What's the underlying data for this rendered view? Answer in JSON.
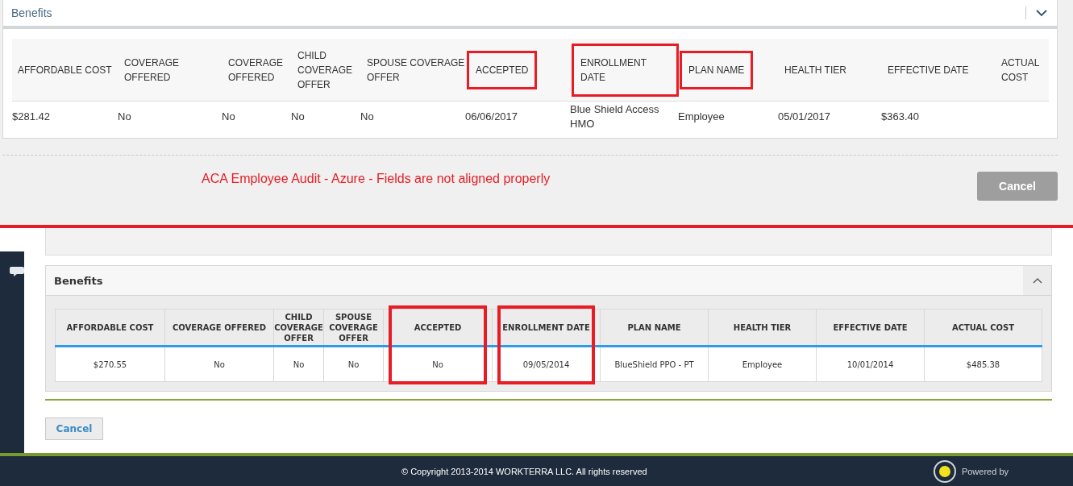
{
  "top": {
    "panel_title": "Benefits",
    "columns": [
      {
        "label": "AFFORDABLE COST",
        "highlighted": false
      },
      {
        "label": "COVERAGE OFFERED",
        "highlighted": false
      },
      {
        "label": "COVERAGE OFFERED",
        "highlighted": false
      },
      {
        "label": "CHILD COVERAGE OFFER",
        "highlighted": false
      },
      {
        "label": "SPOUSE COVERAGE OFFER",
        "highlighted": false
      },
      {
        "label": "ACCEPTED",
        "highlighted": true
      },
      {
        "label": "ENROLLMENT DATE",
        "highlighted": true
      },
      {
        "label": "PLAN NAME",
        "highlighted": true
      },
      {
        "label": "HEALTH TIER",
        "highlighted": false
      },
      {
        "label": "EFFECTIVE DATE",
        "highlighted": false
      },
      {
        "label": "ACTUAL COST",
        "highlighted": false
      }
    ],
    "row": [
      "$281.42",
      "No",
      "No",
      "No",
      "No",
      "06/06/2017",
      "Blue Shield Access HMO",
      "Employee",
      "05/01/2017",
      "$363.40"
    ],
    "annotation": "ACA Employee Audit - Azure - Fields are not aligned properly",
    "cancel": "Cancel"
  },
  "bottom": {
    "panel_title": "Benefits",
    "columns": [
      {
        "label": "AFFORDABLE COST",
        "highlighted": false
      },
      {
        "label": "COVERAGE OFFERED",
        "highlighted": false
      },
      {
        "label": "CHILD COVERAGE OFFER",
        "highlighted": false
      },
      {
        "label": "SPOUSE COVERAGE OFFER",
        "highlighted": false
      },
      {
        "label": "ACCEPTED",
        "highlighted": true
      },
      {
        "label": "ENROLLMENT DATE",
        "highlighted": true
      },
      {
        "label": "PLAN NAME",
        "highlighted": false
      },
      {
        "label": "HEALTH TIER",
        "highlighted": false
      },
      {
        "label": "EFFECTIVE DATE",
        "highlighted": false
      },
      {
        "label": "ACTUAL COST",
        "highlighted": false
      }
    ],
    "row": [
      "$270.55",
      "No",
      "No",
      "No",
      "No",
      "09/05/2014",
      "BlueShield PPO - PT",
      "Employee",
      "10/01/2014",
      "$485.38"
    ],
    "cancel": "Cancel"
  },
  "footer": {
    "copyright": "© Copyright 2013-2014 WORKTERRA LLC. All rights reserved",
    "powered_by": "Powered by"
  }
}
